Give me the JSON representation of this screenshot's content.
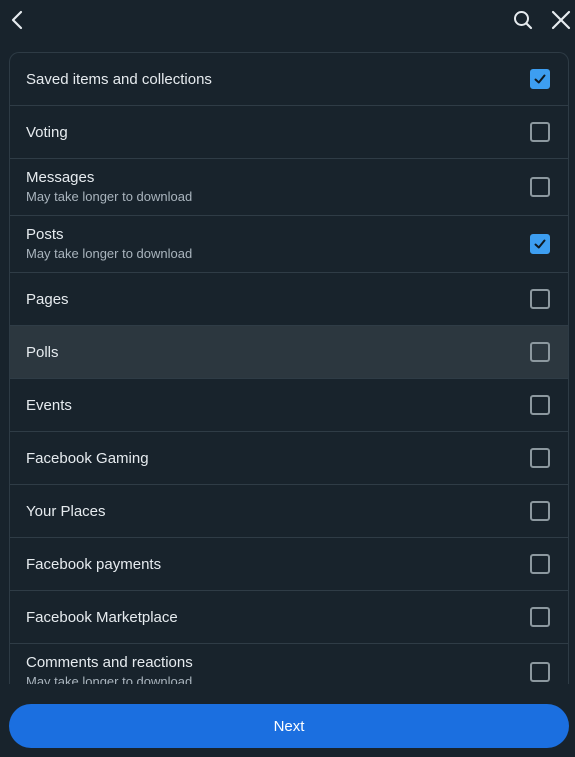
{
  "header": {
    "back_icon": "chevron-left-icon",
    "search_icon": "search-icon",
    "close_icon": "close-icon"
  },
  "items": [
    {
      "title": "Saved items and collections",
      "subtitle": "",
      "checked": true
    },
    {
      "title": "Voting",
      "subtitle": "",
      "checked": false
    },
    {
      "title": "Messages",
      "subtitle": "May take longer to download",
      "checked": false
    },
    {
      "title": "Posts",
      "subtitle": "May take longer to download",
      "checked": true
    },
    {
      "title": "Pages",
      "subtitle": "",
      "checked": false
    },
    {
      "title": "Polls",
      "subtitle": "",
      "checked": false
    },
    {
      "title": "Events",
      "subtitle": "",
      "checked": false
    },
    {
      "title": "Facebook Gaming",
      "subtitle": "",
      "checked": false
    },
    {
      "title": "Your Places",
      "subtitle": "",
      "checked": false
    },
    {
      "title": "Facebook payments",
      "subtitle": "",
      "checked": false
    },
    {
      "title": "Facebook Marketplace",
      "subtitle": "",
      "checked": false
    },
    {
      "title": "Comments and reactions",
      "subtitle": "May take longer to download",
      "checked": false
    }
  ],
  "footer": {
    "next_label": "Next"
  },
  "colors": {
    "background": "#18232c",
    "accent": "#1b6fe0",
    "checkbox_checked": "#3d9ef1"
  }
}
